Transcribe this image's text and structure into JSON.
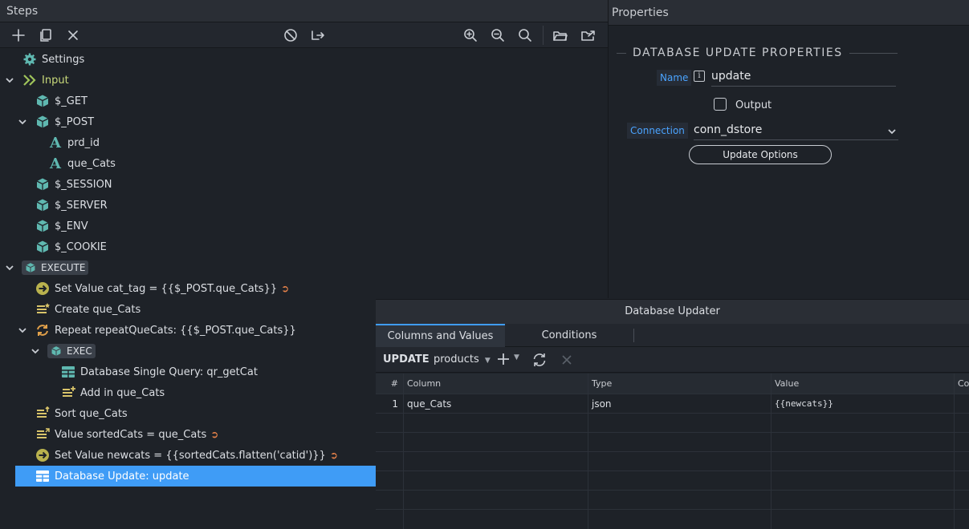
{
  "steps_panel": {
    "title": "Steps",
    "tree": [
      {
        "label": "Settings"
      },
      {
        "label": "Input"
      },
      {
        "label": "$_GET"
      },
      {
        "label": "$_POST"
      },
      {
        "label": "prd_id"
      },
      {
        "label": "que_Cats"
      },
      {
        "label": "$_SESSION"
      },
      {
        "label": "$_SERVER"
      },
      {
        "label": "$_ENV"
      },
      {
        "label": "$_COOKIE"
      },
      {
        "label": "EXECUTE"
      },
      {
        "label": "Set Value cat_tag = {{$_POST.que_Cats}}"
      },
      {
        "label": "Create que_Cats"
      },
      {
        "label": "Repeat repeatQueCats: {{$_POST.que_Cats}}"
      },
      {
        "label": "EXEC"
      },
      {
        "label": "Database Single Query: qr_getCat"
      },
      {
        "label": "Add in que_Cats"
      },
      {
        "label": "Sort que_Cats"
      },
      {
        "label": "Value sortedCats = que_Cats"
      },
      {
        "label": "Set Value newcats = {{sortedCats.flatten('catid')}}"
      },
      {
        "label": "Database Update: update"
      }
    ]
  },
  "properties_panel": {
    "title": "Properties",
    "heading": "DATABASE UPDATE PROPERTIES",
    "name_label": "Name",
    "name_value": "update",
    "output_label": "Output",
    "connection_label": "Connection",
    "connection_value": "conn_dstore",
    "update_options_button": "Update Options"
  },
  "db_updater": {
    "title": "Database Updater",
    "tabs": [
      "Columns and Values",
      "Conditions"
    ],
    "update_label": "UPDATE",
    "table_select": "products",
    "columns": [
      "#",
      "Column",
      "Type",
      "Value",
      "Co"
    ],
    "rows": [
      {
        "num": "1",
        "column": "que_Cats",
        "type": "json",
        "value": "{{newcats}}"
      }
    ]
  },
  "colors": {
    "accent": "#3f9cf6",
    "icon_teal": "#5fb8b0",
    "icon_green": "#9fc35a",
    "output_arrow": "#e8834a"
  }
}
